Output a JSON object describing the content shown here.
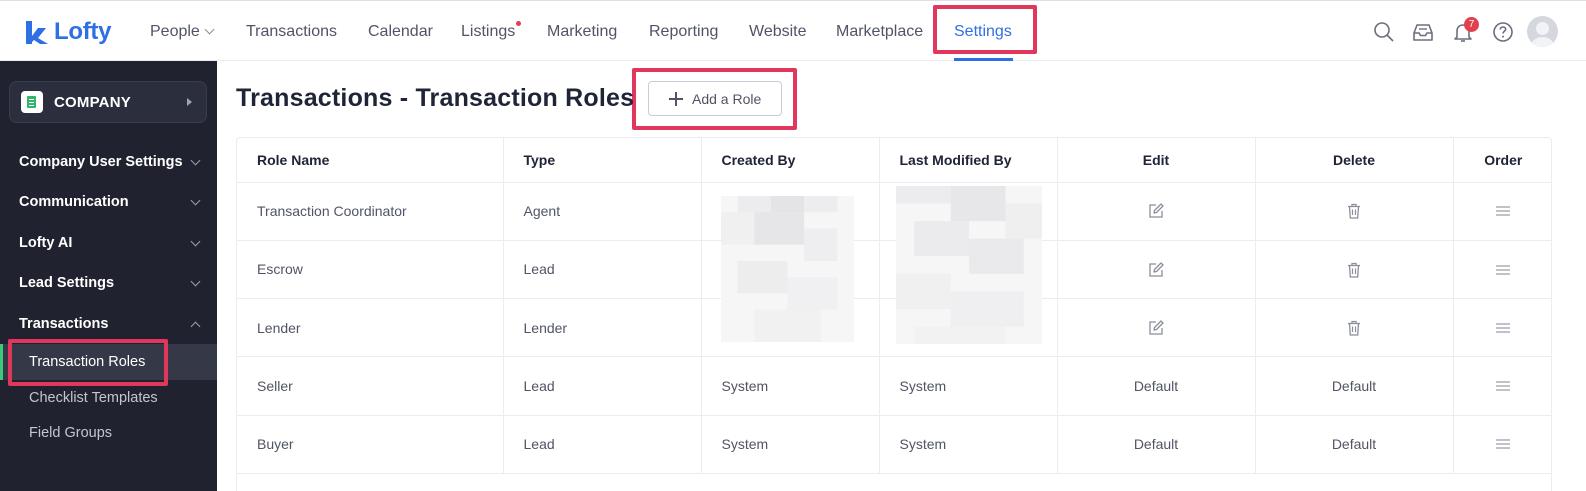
{
  "app": {
    "logo_text": "Lofty"
  },
  "nav": {
    "items": [
      "People",
      "Transactions",
      "Calendar",
      "Listings",
      "Marketing",
      "Reporting",
      "Website",
      "Marketplace",
      "Settings"
    ],
    "active": "Settings",
    "notification_count": "7"
  },
  "sidebar": {
    "company_label": "COMPANY",
    "sections": [
      "Company User Settings",
      "Communication",
      "Lofty AI",
      "Lead Settings",
      "Transactions"
    ],
    "subitems": [
      "Transaction Roles",
      "Checklist Templates",
      "Field Groups"
    ],
    "active_subitem": "Transaction Roles"
  },
  "page": {
    "title": "Transactions - Transaction Roles",
    "add_button_label": "Add a Role"
  },
  "table": {
    "headers": [
      "Role Name",
      "Type",
      "Created By",
      "Last Modified By",
      "Edit",
      "Delete",
      "Order"
    ],
    "rows": [
      {
        "role": "Transaction Coordinator",
        "type": "Agent",
        "created_by": "",
        "modified_by": "",
        "edit": "edit-icon",
        "delete": "trash-icon"
      },
      {
        "role": "Escrow",
        "type": "Lead",
        "created_by": "",
        "modified_by": "",
        "edit": "edit-icon",
        "delete": "trash-icon"
      },
      {
        "role": "Lender",
        "type": "Lender",
        "created_by": "",
        "modified_by": "",
        "edit": "edit-icon",
        "delete": "trash-icon"
      },
      {
        "role": "Seller",
        "type": "Lead",
        "created_by": "System",
        "modified_by": "System",
        "edit": "Default",
        "delete": "Default"
      },
      {
        "role": "Buyer",
        "type": "Lead",
        "created_by": "System",
        "modified_by": "System",
        "edit": "Default",
        "delete": "Default"
      }
    ]
  },
  "colors": {
    "accent": "#2f6fe4",
    "highlight": "#e2375d",
    "sidebar_bg": "#20232f",
    "sidebar_active_bar": "#3ec97a"
  }
}
